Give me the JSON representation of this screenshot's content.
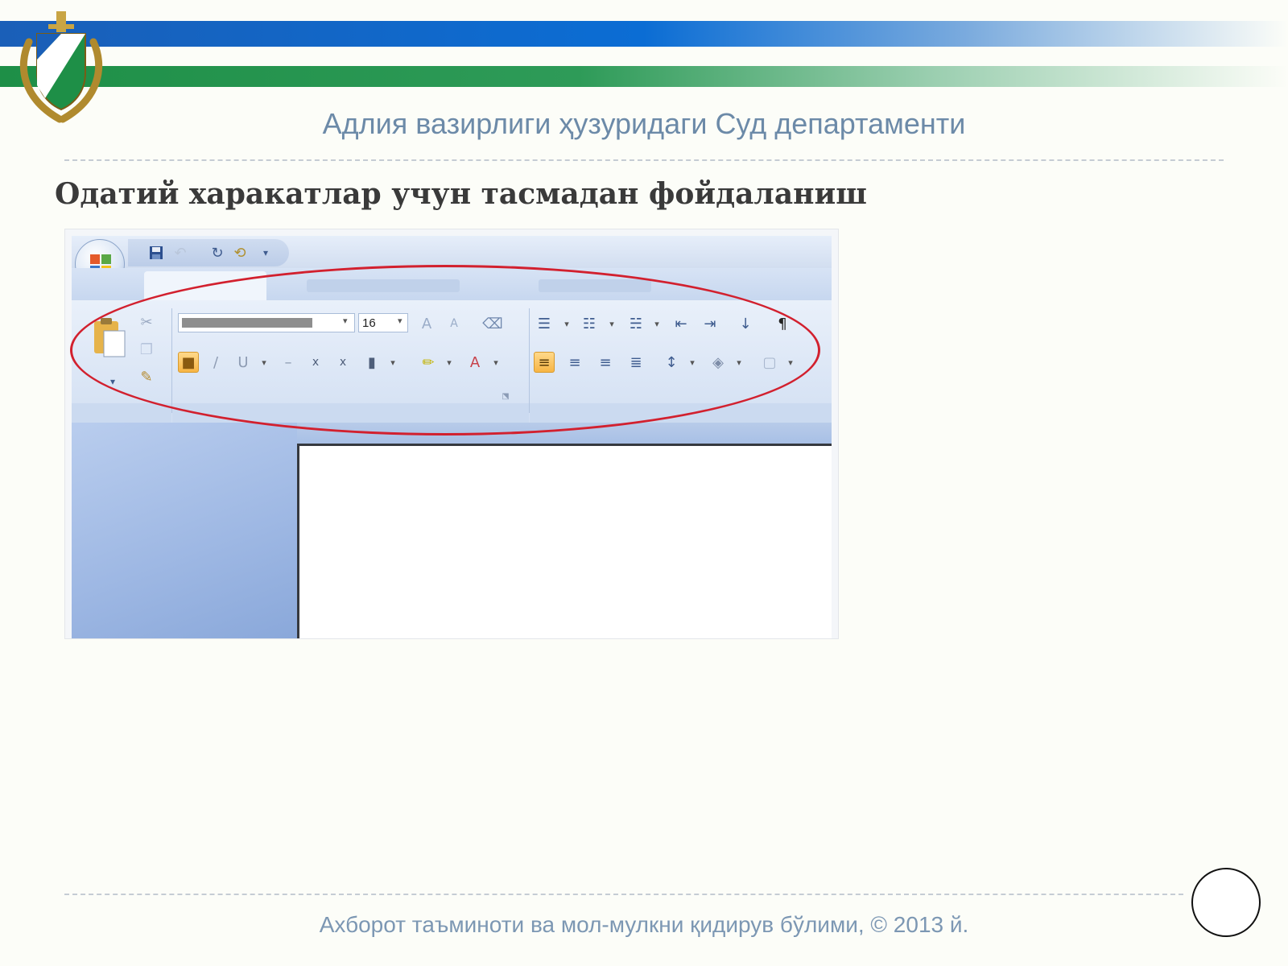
{
  "header": {
    "organization": "Адлия вазирлиги ҳузуридаги Суд департаменти"
  },
  "slide": {
    "title": "Одатий харакатлар учун тасмадан фойдаланиш"
  },
  "screenshot": {
    "font_size_value": "16",
    "paragraph_mark": "¶"
  },
  "footer": {
    "text": "Ахборот таъминоти ва мол-мулкни қидирув бўлими, © 2013 й."
  },
  "colors": {
    "blue_band": "#0b6dd4",
    "green_band": "#2e9b58",
    "highlight_ellipse": "#d2202e",
    "header_text": "#6c8aa8"
  }
}
